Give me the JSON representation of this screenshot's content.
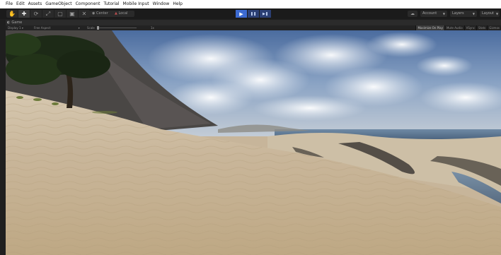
{
  "menu": [
    "File",
    "Edit",
    "Assets",
    "GameObject",
    "Component",
    "Tutorial",
    "Mobile Input",
    "Window",
    "Help"
  ],
  "toolbar": {
    "tools": [
      {
        "name": "hand-tool-button",
        "icon": "hand-icon",
        "glyph": "✋"
      },
      {
        "name": "move-tool-button",
        "icon": "move-icon",
        "glyph": "✚"
      },
      {
        "name": "rotate-tool-button",
        "icon": "rotate-icon",
        "glyph": "⟳"
      },
      {
        "name": "scale-tool-button",
        "icon": "scale-icon",
        "glyph": "⤢"
      },
      {
        "name": "rect-tool-button",
        "icon": "rect-icon",
        "glyph": "▢"
      },
      {
        "name": "transform-tool-button",
        "icon": "transform-icon",
        "glyph": "▣"
      },
      {
        "name": "custom-tool-button",
        "icon": "custom-tool-icon",
        "glyph": "✕"
      }
    ],
    "active_tool": 1,
    "pivot": "Center",
    "space": "Local",
    "account": "Account",
    "layers": "Layers",
    "layout": "Layout"
  },
  "play_controls": {
    "play_icon": "▶",
    "pause_icon": "❚❚",
    "step_icon": "▶❚",
    "play_active": true
  },
  "game_view": {
    "tab_label": "Game",
    "display": "Display 1",
    "aspect": "Free Aspect",
    "scale_label": "Scale",
    "scale_value": "1x",
    "buttons": [
      "Maximize On Play",
      "Mute Audio",
      "VSync",
      "Stats",
      "Gizmos"
    ]
  },
  "colors": {
    "play_active": "#3c6ad1",
    "play_inactive": "#2b3f74",
    "sky_top": "#4f6fa0",
    "sand": "#c9b79b"
  }
}
